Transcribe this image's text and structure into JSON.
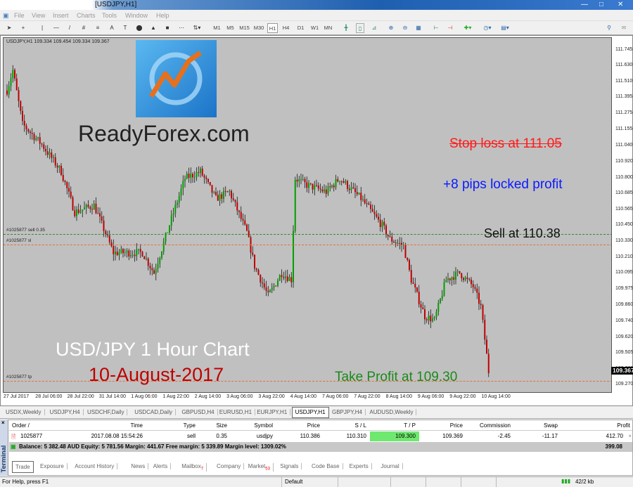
{
  "window": {
    "title": "[USDJPY,H1]"
  },
  "menu": [
    "File",
    "View",
    "Insert",
    "Charts",
    "Tools",
    "Window",
    "Help"
  ],
  "timeframes": [
    "M1",
    "M5",
    "M15",
    "M30",
    "H1",
    "H4",
    "D1",
    "W1",
    "MN"
  ],
  "active_timeframe": "H1",
  "chart": {
    "header": "USDJPY,H1  109.334 109.454 109.334 109.367",
    "price_ticks": [
      "111.745",
      "111.630",
      "111.510",
      "111.395",
      "111.275",
      "111.155",
      "111.040",
      "110.920",
      "110.800",
      "110.685",
      "110.565",
      "110.450",
      "110.330",
      "110.210",
      "110.095",
      "109.975",
      "109.860",
      "109.740",
      "109.620",
      "109.505",
      "109.385",
      "109.270"
    ],
    "current_price": "109.367",
    "time_ticks": [
      "27 Jul 2017",
      "28 Jul 06:00",
      "28 Jul 22:00",
      "31 Jul 14:00",
      "1 Aug 06:00",
      "1 Aug 22:00",
      "2 Aug 14:00",
      "3 Aug 06:00",
      "3 Aug 22:00",
      "4 Aug 14:00",
      "7 Aug 06:00",
      "7 Aug 22:00",
      "8 Aug 14:00",
      "9 Aug 06:00",
      "9 Aug 22:00",
      "10 Aug 14:00"
    ],
    "price_range": [
      109.27,
      111.745
    ],
    "price_path": [
      [
        0,
        111.45
      ],
      [
        3,
        111.6
      ],
      [
        8,
        111.2
      ],
      [
        18,
        111.05
      ],
      [
        28,
        110.85
      ],
      [
        35,
        110.55
      ],
      [
        45,
        110.6
      ],
      [
        55,
        110.25
      ],
      [
        70,
        110.25
      ],
      [
        76,
        110.1
      ],
      [
        85,
        110.5
      ],
      [
        92,
        110.8
      ],
      [
        100,
        110.85
      ],
      [
        108,
        110.65
      ],
      [
        115,
        110.7
      ],
      [
        124,
        110.4
      ],
      [
        128,
        110.15
      ],
      [
        135,
        109.93
      ],
      [
        142,
        110.1
      ],
      [
        147,
        110.05
      ],
      [
        149,
        110.8
      ],
      [
        155,
        110.75
      ],
      [
        165,
        110.7
      ],
      [
        172,
        110.8
      ],
      [
        183,
        110.65
      ],
      [
        194,
        110.45
      ],
      [
        198,
        110.35
      ],
      [
        205,
        110.3
      ],
      [
        209,
        110.05
      ],
      [
        216,
        109.78
      ],
      [
        221,
        109.75
      ],
      [
        227,
        110.05
      ],
      [
        234,
        110.1
      ],
      [
        241,
        110.0
      ],
      [
        245,
        109.85
      ],
      [
        249,
        109.37
      ]
    ],
    "orders": [
      {
        "label": "#1025877 sell 0.35",
        "price": 110.386,
        "color": "#2e8b2e"
      },
      {
        "label": "#1025877 sl",
        "price": 110.31,
        "color": "#e07040"
      },
      {
        "label": "#1025877 tp",
        "price": 109.3,
        "color": "#e07040"
      }
    ],
    "bull_color": "#00a000",
    "bear_color": "#c00000"
  },
  "overlay": {
    "brand": "ReadyForex.com",
    "stop_loss": "Stop loss at 111.05",
    "locked_profit": "+8 pips locked profit",
    "sell": "Sell at 110.38",
    "chart_title": "USD/JPY 1 Hour Chart",
    "date": "10-August-2017",
    "take_profit": "Take Profit at 109.30"
  },
  "chart_tabs": [
    "USDX,Weekly",
    "USDJPY,H4",
    "USDCHF,Daily",
    "USDCAD,Daily",
    "GBPUSD,H4",
    "EURUSD,H1",
    "EURJPY,H1",
    "USDJPY,H1",
    "GBPJPY,H4",
    "AUDUSD,Weekly"
  ],
  "active_chart_tab": "USDJPY,H1",
  "terminal": {
    "side_label": "Terminal",
    "columns": [
      "Order  /",
      "Time",
      "Type",
      "Size",
      "Symbol",
      "Price",
      "S / L",
      "T / P",
      "Price",
      "Commission",
      "Swap",
      "Profit"
    ],
    "order": [
      "1025877",
      "2017.08.08 15:54:26",
      "sell",
      "0.35",
      "usdjpy",
      "110.386",
      "110.310",
      "109.300",
      "109.369",
      "-2.45",
      "-11.17",
      "412.70"
    ],
    "balance": "Balance: 5 382.48 AUD  Equity: 5 781.56  Margin: 441.67  Free margin: 5 339.89  Margin level: 1309.02%",
    "total": "399.08",
    "tabs": [
      "Trade",
      "Exposure",
      "Account History",
      "News",
      "Alerts",
      "Mailbox",
      "Company",
      "Market",
      "Signals",
      "Code Base",
      "Experts",
      "Journal"
    ],
    "mailbox_badge": "7",
    "market_badge": "53"
  },
  "status": {
    "help": "For Help, press F1",
    "profile": "Default",
    "traffic": "42/2 kb"
  }
}
